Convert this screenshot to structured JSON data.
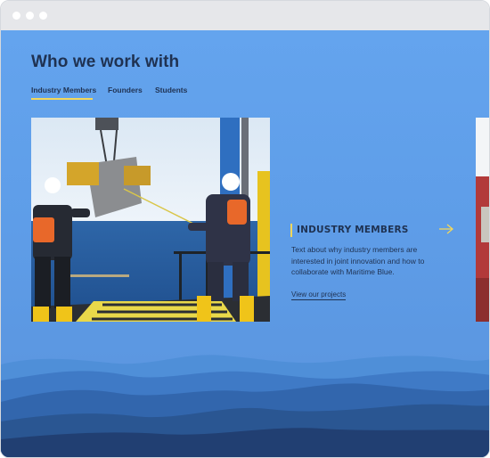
{
  "section": {
    "heading": "Who we work with",
    "tabs": [
      {
        "label": "Industry Members",
        "active": true
      },
      {
        "label": "Founders",
        "active": false
      },
      {
        "label": "Students",
        "active": false
      }
    ]
  },
  "card": {
    "title": "INDUSTRY MEMBERS",
    "body": "Text about why industry members are interested in joint innovation and how to collaborate with Maritime Blue.",
    "link": "View our projects",
    "arrow_icon": "arrow-right-icon"
  },
  "colors": {
    "accent": "#f3d75a",
    "text": "#1f3252",
    "background": "#64a4ee"
  }
}
